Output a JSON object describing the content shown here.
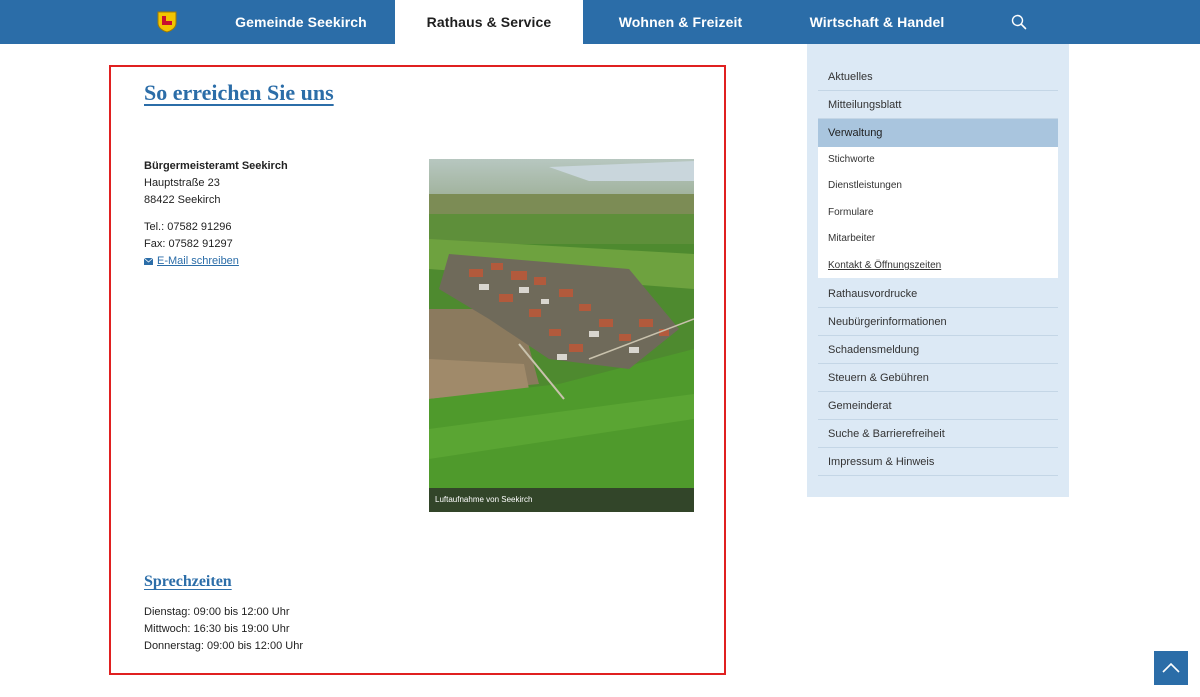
{
  "nav": {
    "items": [
      {
        "label": "Gemeinde Seekirch"
      },
      {
        "label": "Rathaus & Service"
      },
      {
        "label": "Wohnen & Freizeit"
      },
      {
        "label": "Wirtschaft & Handel"
      }
    ],
    "active_index": 1
  },
  "content": {
    "title": "So erreichen Sie uns",
    "address": {
      "name": "Bürgermeisteramt Seekirch",
      "street": "Hauptstraße 23",
      "city": "88422  Seekirch",
      "tel": "Tel.: 07582 91296",
      "fax": "Fax: 07582 91297",
      "email_link": "E-Mail schreiben"
    },
    "photo_caption": "Luftaufnahme von Seekirch",
    "hours_title": "Sprechzeiten",
    "hours": [
      "Dienstag: 09:00 bis 12:00 Uhr",
      "Mittwoch: 16:30 bis 19:00 Uhr",
      "Donnerstag: 09:00 bis 12:00 Uhr"
    ]
  },
  "sidebar": {
    "items": [
      "Aktuelles",
      "Mitteilungsblatt",
      "Verwaltung",
      "Rathausvordrucke",
      "Neubürgerinformationen",
      "Schadensmeldung",
      "Steuern & Gebühren",
      "Gemeinderat",
      "Suche & Barrierefreiheit",
      "Impressum & Hinweis"
    ],
    "sub_items": [
      "Stichworte",
      "Dienstleistungen",
      "Formulare",
      "Mitarbeiter",
      "Kontakt & Öffnungszeiten"
    ]
  },
  "colors": {
    "brand_blue": "#2b6da8",
    "sidebar_bg": "#dce9f5",
    "sidebar_active": "#a9c5de",
    "highlight_frame": "#e02020"
  },
  "icons": {
    "logo": "coat-of-arms-icon",
    "search": "search-icon",
    "mail": "envelope-icon",
    "scroll_top": "chevron-up-icon"
  }
}
